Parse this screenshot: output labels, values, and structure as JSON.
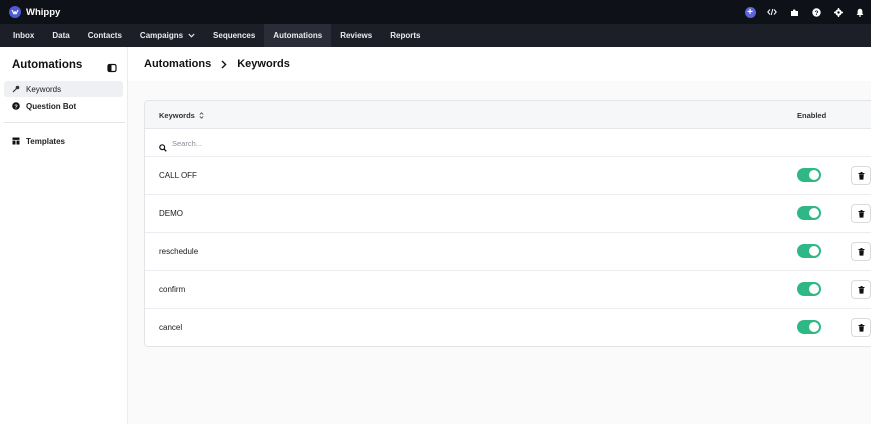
{
  "app": {
    "name": "Whippy"
  },
  "top_icons": [
    "plus-icon",
    "code-icon",
    "puzzle-icon",
    "help-icon",
    "gear-icon",
    "bell-icon"
  ],
  "nav": {
    "items": [
      {
        "label": "Inbox",
        "active": false
      },
      {
        "label": "Data",
        "active": false
      },
      {
        "label": "Contacts",
        "active": false
      },
      {
        "label": "Campaigns",
        "active": false,
        "dropdown": true
      },
      {
        "label": "Sequences",
        "active": false
      },
      {
        "label": "Automations",
        "active": true
      },
      {
        "label": "Reviews",
        "active": false
      },
      {
        "label": "Reports",
        "active": false
      }
    ]
  },
  "sidebar": {
    "title": "Automations",
    "items": [
      {
        "label": "Keywords",
        "icon": "key-icon",
        "active": true
      },
      {
        "label": "Question Bot",
        "icon": "question-circle-icon",
        "active": false
      },
      {
        "label": "Templates",
        "icon": "template-icon",
        "active": false
      }
    ]
  },
  "breadcrumb": {
    "parent": "Automations",
    "current": "Keywords"
  },
  "table": {
    "col_keywords": "Keywords",
    "col_enabled": "Enabled",
    "search_placeholder": "Search...",
    "rows": [
      {
        "keyword": "CALL OFF",
        "enabled": true
      },
      {
        "keyword": "DEMO",
        "enabled": true
      },
      {
        "keyword": "reschedule",
        "enabled": true
      },
      {
        "keyword": "confirm",
        "enabled": true
      },
      {
        "keyword": "cancel",
        "enabled": true
      }
    ]
  },
  "colors": {
    "toggle_on": "#2fb886",
    "topbar": "#0f1118",
    "navbar": "#1c1f28",
    "accent": "#5d63d8"
  }
}
